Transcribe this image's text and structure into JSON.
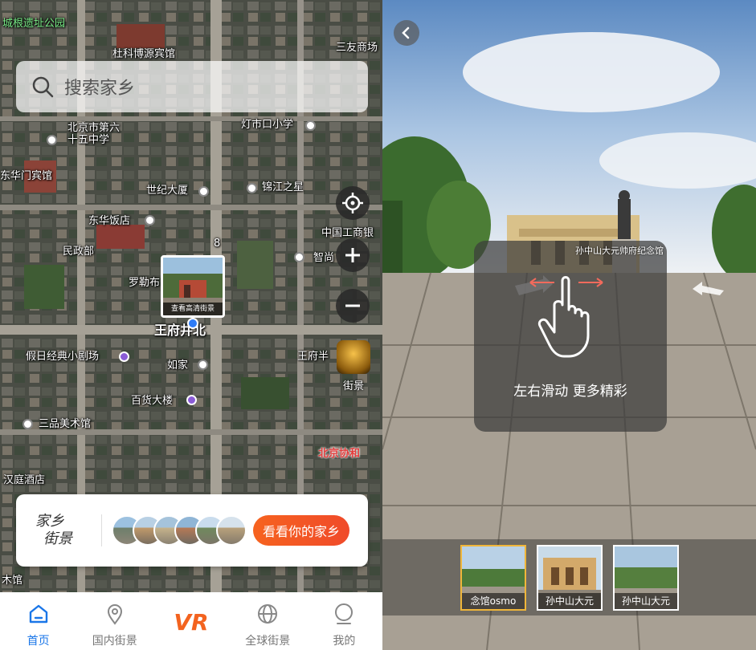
{
  "map": {
    "labels": [
      {
        "id": "chenggen-park",
        "text": "城根遗址公园",
        "style": "green"
      },
      {
        "id": "dulingbo-hotel",
        "text": "杜科博源宾馆",
        "style": ""
      },
      {
        "id": "sanyou-mall",
        "text": "三友商场",
        "style": ""
      },
      {
        "id": "beijing-26",
        "text": "北京市第六\n十五中学",
        "style": ""
      },
      {
        "id": "dengshikou-school",
        "text": "灯市口小学",
        "style": ""
      },
      {
        "id": "dongmen-hotel",
        "text": "东华门宾馆",
        "style": ""
      },
      {
        "id": "century-building",
        "text": "世纪大厦",
        "style": ""
      },
      {
        "id": "jinjiang-star",
        "text": "锦江之星",
        "style": ""
      },
      {
        "id": "donghua-hotel",
        "text": "东华饭店",
        "style": ""
      },
      {
        "id": "icbc",
        "text": "中国工商银",
        "style": ""
      },
      {
        "id": "minzheng",
        "text": "民政部",
        "style": ""
      },
      {
        "id": "zhifu",
        "text": "智尚",
        "style": ""
      },
      {
        "id": "luole",
        "text": "罗勒布",
        "style": ""
      },
      {
        "id": "wangfujing-north",
        "text": "王府井北",
        "style": "big"
      },
      {
        "id": "theater",
        "text": "假日经典小剧场",
        "style": ""
      },
      {
        "id": "wangfu-half",
        "text": "王府半",
        "style": ""
      },
      {
        "id": "rujia",
        "text": "如家",
        "style": ""
      },
      {
        "id": "department-store",
        "text": "百货大楼",
        "style": ""
      },
      {
        "id": "sanpin-gallery",
        "text": "三品美术馆",
        "style": ""
      },
      {
        "id": "xiehe",
        "text": "北京协和",
        "style": "red"
      },
      {
        "id": "hanyuan-hotel",
        "text": "汉庭酒店",
        "style": ""
      },
      {
        "id": "muguan",
        "text": "木馆",
        "style": ""
      }
    ],
    "road_number": "8",
    "street_thumb_caption": "查看高清街景",
    "street_button_label": "街景"
  },
  "search": {
    "placeholder": "搜索家乡"
  },
  "promo": {
    "title_line1": "家乡",
    "title_line2": "街景",
    "button_label": "看看你的家乡"
  },
  "tabbar": [
    {
      "id": "home",
      "label": "首页",
      "icon": "home-icon",
      "active": true
    },
    {
      "id": "domestic",
      "label": "国内街景",
      "icon": "location-pin-icon",
      "active": false
    },
    {
      "id": "vr",
      "label": "VR",
      "icon": "vr-logo-icon",
      "active": false
    },
    {
      "id": "global",
      "label": "全球街景",
      "icon": "globe-icon",
      "active": false
    },
    {
      "id": "mine",
      "label": "我的",
      "icon": "user-icon",
      "active": false
    }
  ],
  "streetview": {
    "hint_text": "左右滑动 更多精彩",
    "scene_name": "孙中山大元帅府纪念馆",
    "thumbnails": [
      {
        "caption": "念馆osmo",
        "selected": true
      },
      {
        "caption": "孙中山大元",
        "selected": false
      },
      {
        "caption": "孙中山大元",
        "selected": false
      }
    ]
  },
  "colors": {
    "accent_blue": "#1a76e8",
    "accent_orange": "#f3631f",
    "thumb_selected": "#f0b63a"
  }
}
